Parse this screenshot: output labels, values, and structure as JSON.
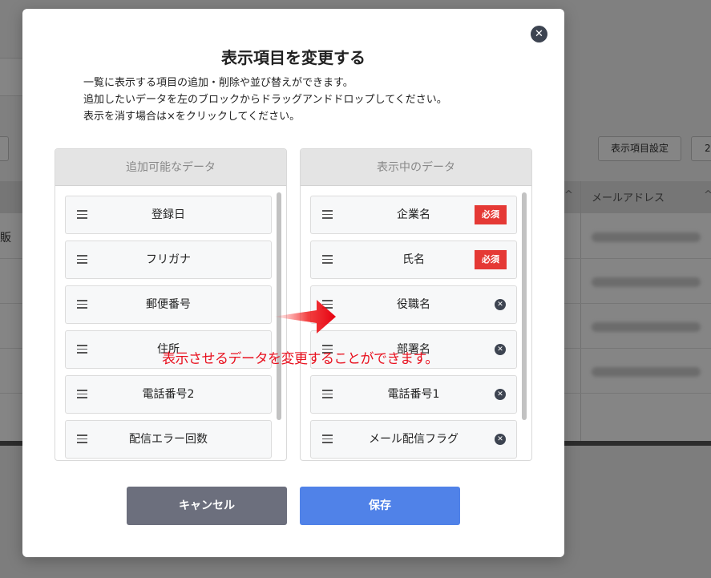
{
  "background": {
    "toolbar_button": "表示項目設定",
    "toolbar_button_2": "2",
    "column_header": "メールアドレス",
    "left_cell_text": "販",
    "sort_glyph": "^"
  },
  "modal": {
    "title": "表示項目を変更する",
    "close_glyph": "✕",
    "description": [
      "一覧に表示する項目の追加・削除や並び替えができます。",
      "追加したいデータを左のブロックからドラッグアンドドロップしてください。",
      "表示を消す場合は×をクリックしてください。"
    ],
    "left_panel": {
      "title": "追加可能なデータ",
      "items": [
        "登録日",
        "フリガナ",
        "郵便番号",
        "住所",
        "電話番号2",
        "配信エラー回数"
      ]
    },
    "right_panel": {
      "title": "表示中のデータ",
      "items": [
        {
          "label": "企業名",
          "badge": "必須"
        },
        {
          "label": "氏名",
          "badge": "必須"
        },
        {
          "label": "役職名",
          "remove": "✕"
        },
        {
          "label": "部署名",
          "remove": "✕"
        },
        {
          "label": "電話番号1",
          "remove": "✕"
        },
        {
          "label": "メール配信フラグ",
          "remove": "✕"
        }
      ]
    },
    "cancel_label": "キャンセル",
    "save_label": "保存"
  },
  "annotation": {
    "text": "表示させるデータを変更することができます。",
    "color": "#e8101e"
  },
  "colors": {
    "cancel": "#6c6f7d",
    "save": "#5082e8",
    "required_badge": "#e53935"
  }
}
